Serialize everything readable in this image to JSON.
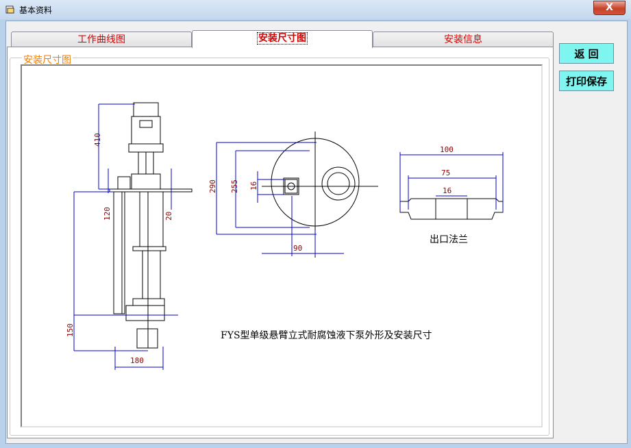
{
  "window": {
    "title": "基本资料",
    "close_label": "X"
  },
  "tabs": [
    {
      "label": "工作曲线图"
    },
    {
      "label": "安装尺寸图"
    },
    {
      "label": "安装信息"
    }
  ],
  "group": {
    "label": "安装尺寸图"
  },
  "buttons": {
    "back": "返 回",
    "print_save": "打印保存"
  },
  "drawing": {
    "dims": {
      "d410": "410",
      "d120": "120",
      "d20": "20",
      "d150": "150",
      "d180": "180",
      "d290": "290",
      "d255": "255",
      "d16a": "16",
      "d90": "90",
      "d100": "100",
      "d75": "75",
      "d16b": "16"
    },
    "flange_label": "出口法兰",
    "caption": "FYS型单级悬臂立式耐腐蚀液下泵外形及安装尺寸"
  },
  "colors": {
    "dimension_line": "#0000cc",
    "outline": "#000000",
    "dimension_text": "#8b0000"
  }
}
